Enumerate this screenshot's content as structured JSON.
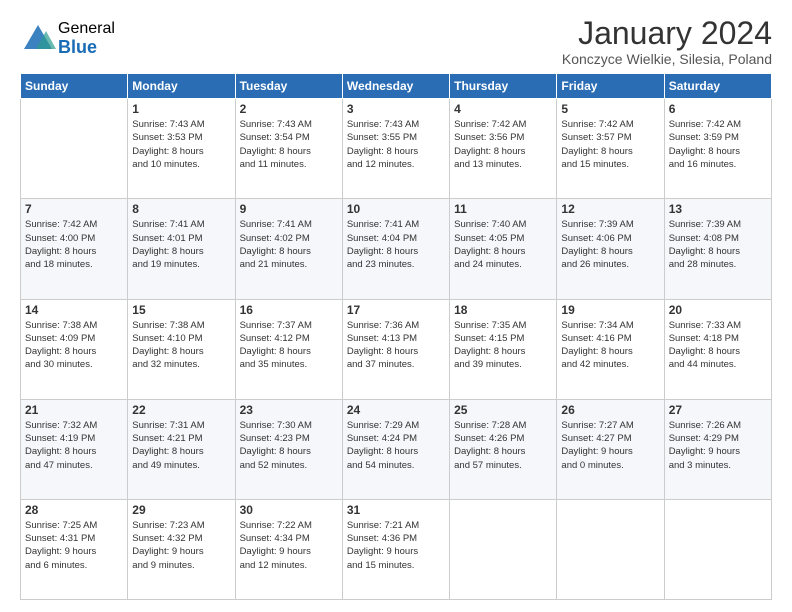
{
  "logo": {
    "general": "General",
    "blue": "Blue"
  },
  "header": {
    "title": "January 2024",
    "subtitle": "Konczyce Wielkie, Silesia, Poland"
  },
  "days_of_week": [
    "Sunday",
    "Monday",
    "Tuesday",
    "Wednesday",
    "Thursday",
    "Friday",
    "Saturday"
  ],
  "weeks": [
    [
      {
        "day": "",
        "info": ""
      },
      {
        "day": "1",
        "info": "Sunrise: 7:43 AM\nSunset: 3:53 PM\nDaylight: 8 hours\nand 10 minutes."
      },
      {
        "day": "2",
        "info": "Sunrise: 7:43 AM\nSunset: 3:54 PM\nDaylight: 8 hours\nand 11 minutes."
      },
      {
        "day": "3",
        "info": "Sunrise: 7:43 AM\nSunset: 3:55 PM\nDaylight: 8 hours\nand 12 minutes."
      },
      {
        "day": "4",
        "info": "Sunrise: 7:42 AM\nSunset: 3:56 PM\nDaylight: 8 hours\nand 13 minutes."
      },
      {
        "day": "5",
        "info": "Sunrise: 7:42 AM\nSunset: 3:57 PM\nDaylight: 8 hours\nand 15 minutes."
      },
      {
        "day": "6",
        "info": "Sunrise: 7:42 AM\nSunset: 3:59 PM\nDaylight: 8 hours\nand 16 minutes."
      }
    ],
    [
      {
        "day": "7",
        "info": "Sunrise: 7:42 AM\nSunset: 4:00 PM\nDaylight: 8 hours\nand 18 minutes."
      },
      {
        "day": "8",
        "info": "Sunrise: 7:41 AM\nSunset: 4:01 PM\nDaylight: 8 hours\nand 19 minutes."
      },
      {
        "day": "9",
        "info": "Sunrise: 7:41 AM\nSunset: 4:02 PM\nDaylight: 8 hours\nand 21 minutes."
      },
      {
        "day": "10",
        "info": "Sunrise: 7:41 AM\nSunset: 4:04 PM\nDaylight: 8 hours\nand 23 minutes."
      },
      {
        "day": "11",
        "info": "Sunrise: 7:40 AM\nSunset: 4:05 PM\nDaylight: 8 hours\nand 24 minutes."
      },
      {
        "day": "12",
        "info": "Sunrise: 7:39 AM\nSunset: 4:06 PM\nDaylight: 8 hours\nand 26 minutes."
      },
      {
        "day": "13",
        "info": "Sunrise: 7:39 AM\nSunset: 4:08 PM\nDaylight: 8 hours\nand 28 minutes."
      }
    ],
    [
      {
        "day": "14",
        "info": "Sunrise: 7:38 AM\nSunset: 4:09 PM\nDaylight: 8 hours\nand 30 minutes."
      },
      {
        "day": "15",
        "info": "Sunrise: 7:38 AM\nSunset: 4:10 PM\nDaylight: 8 hours\nand 32 minutes."
      },
      {
        "day": "16",
        "info": "Sunrise: 7:37 AM\nSunset: 4:12 PM\nDaylight: 8 hours\nand 35 minutes."
      },
      {
        "day": "17",
        "info": "Sunrise: 7:36 AM\nSunset: 4:13 PM\nDaylight: 8 hours\nand 37 minutes."
      },
      {
        "day": "18",
        "info": "Sunrise: 7:35 AM\nSunset: 4:15 PM\nDaylight: 8 hours\nand 39 minutes."
      },
      {
        "day": "19",
        "info": "Sunrise: 7:34 AM\nSunset: 4:16 PM\nDaylight: 8 hours\nand 42 minutes."
      },
      {
        "day": "20",
        "info": "Sunrise: 7:33 AM\nSunset: 4:18 PM\nDaylight: 8 hours\nand 44 minutes."
      }
    ],
    [
      {
        "day": "21",
        "info": "Sunrise: 7:32 AM\nSunset: 4:19 PM\nDaylight: 8 hours\nand 47 minutes."
      },
      {
        "day": "22",
        "info": "Sunrise: 7:31 AM\nSunset: 4:21 PM\nDaylight: 8 hours\nand 49 minutes."
      },
      {
        "day": "23",
        "info": "Sunrise: 7:30 AM\nSunset: 4:23 PM\nDaylight: 8 hours\nand 52 minutes."
      },
      {
        "day": "24",
        "info": "Sunrise: 7:29 AM\nSunset: 4:24 PM\nDaylight: 8 hours\nand 54 minutes."
      },
      {
        "day": "25",
        "info": "Sunrise: 7:28 AM\nSunset: 4:26 PM\nDaylight: 8 hours\nand 57 minutes."
      },
      {
        "day": "26",
        "info": "Sunrise: 7:27 AM\nSunset: 4:27 PM\nDaylight: 9 hours\nand 0 minutes."
      },
      {
        "day": "27",
        "info": "Sunrise: 7:26 AM\nSunset: 4:29 PM\nDaylight: 9 hours\nand 3 minutes."
      }
    ],
    [
      {
        "day": "28",
        "info": "Sunrise: 7:25 AM\nSunset: 4:31 PM\nDaylight: 9 hours\nand 6 minutes."
      },
      {
        "day": "29",
        "info": "Sunrise: 7:23 AM\nSunset: 4:32 PM\nDaylight: 9 hours\nand 9 minutes."
      },
      {
        "day": "30",
        "info": "Sunrise: 7:22 AM\nSunset: 4:34 PM\nDaylight: 9 hours\nand 12 minutes."
      },
      {
        "day": "31",
        "info": "Sunrise: 7:21 AM\nSunset: 4:36 PM\nDaylight: 9 hours\nand 15 minutes."
      },
      {
        "day": "",
        "info": ""
      },
      {
        "day": "",
        "info": ""
      },
      {
        "day": "",
        "info": ""
      }
    ]
  ]
}
